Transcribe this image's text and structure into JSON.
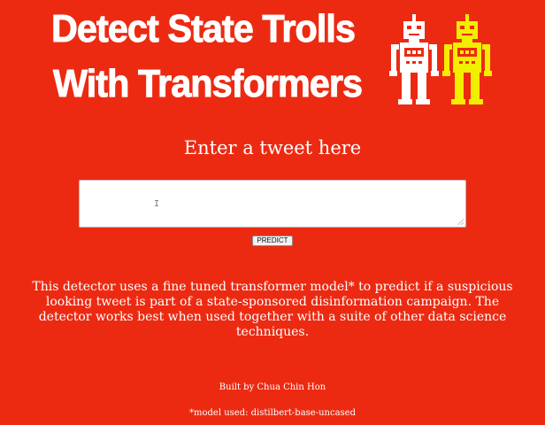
{
  "header": {
    "title_line1": "Detect State Trolls",
    "title_line2": "With Transformers",
    "robot_icons": [
      "white-robot-icon",
      "yellow-robot-icon"
    ]
  },
  "form": {
    "prompt": "Enter a tweet here",
    "tweet_value": "",
    "predict_label": "PREDICT"
  },
  "description": "This detector uses a fine tuned transformer model* to predict if a suspicious looking tweet is part of a state-sponsored disinformation campaign. The detector works best when used together with a suite of other data science techniques.",
  "footer": {
    "credit": "Built by Chua Chin Hon",
    "model_note": "*model used: distilbert-base-uncased"
  },
  "colors": {
    "background": "#ec2a12",
    "text": "#ffffff",
    "robot_primary": "#ffffff",
    "robot_secondary": "#f2ee00"
  }
}
